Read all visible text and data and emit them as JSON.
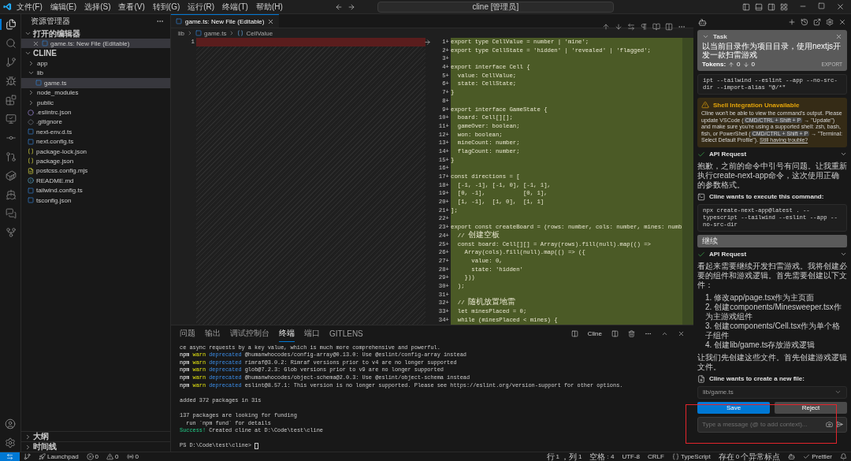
{
  "title_bar": {
    "menus": [
      "文件(F)",
      "编辑(E)",
      "选择(S)",
      "查看(V)",
      "转到(G)",
      "运行(R)",
      "终端(T)",
      "帮助(H)"
    ],
    "search": "cline [管理员]"
  },
  "activity_bar": [
    {
      "selected": true
    },
    {
      "selected": false
    },
    {
      "selected": false
    },
    {
      "selected": false
    },
    {
      "selected": false
    },
    {
      "selected": false
    },
    {
      "selected": false
    },
    {
      "selected": false
    },
    {
      "selected": false
    },
    {
      "selected": false
    },
    {
      "selected": false
    },
    {
      "selected": false
    }
  ],
  "sidebar": {
    "title": "资源管理器",
    "open_editors": {
      "label": "打开的编辑器",
      "expanded": true,
      "items": [
        {
          "name": "game.ts: New File (Editable)",
          "kind": "ts",
          "selected": true
        }
      ]
    },
    "project": {
      "label": "CLINE",
      "expanded": true,
      "tree": [
        {
          "name": "app",
          "kind": "folder",
          "expanded": false,
          "selected": false
        },
        {
          "name": "lib",
          "kind": "folder",
          "expanded": true,
          "selected": false,
          "children": [
            {
              "name": "game.ts",
              "kind": "ts",
              "selected": true
            }
          ]
        },
        {
          "name": "node_modules",
          "kind": "folder",
          "expanded": false,
          "selected": false
        },
        {
          "name": "public",
          "kind": "folder",
          "expanded": false,
          "selected": false
        },
        {
          "name": ".eslintrc.json",
          "kind": "eslint",
          "selected": false
        },
        {
          "name": ".gitignore",
          "kind": "git",
          "selected": false
        },
        {
          "name": "next-env.d.ts",
          "kind": "ts",
          "selected": false
        },
        {
          "name": "next.config.ts",
          "kind": "ts",
          "selected": false
        },
        {
          "name": "package-lock.json",
          "kind": "json",
          "selected": false
        },
        {
          "name": "package.json",
          "kind": "json",
          "selected": false
        },
        {
          "name": "postcss.config.mjs",
          "kind": "js",
          "selected": false
        },
        {
          "name": "README.md",
          "kind": "md",
          "selected": false
        },
        {
          "name": "tailwind.config.ts",
          "kind": "ts",
          "selected": false
        },
        {
          "name": "tsconfig.json",
          "kind": "tsconfig",
          "selected": false
        }
      ]
    },
    "bottom_sections": [
      {
        "label": "大纲",
        "expanded": false
      },
      {
        "label": "时间线",
        "expanded": false
      }
    ]
  },
  "editor": {
    "tabs": [
      {
        "label": "game.ts: New File (Editable)",
        "selected": true
      }
    ],
    "breadcrumb": [
      "lib",
      "game.ts",
      "CellValue"
    ],
    "left_lines": [
      {
        "number": "1"
      }
    ],
    "right_lines": [
      {
        "number": "1+",
        "code": "export type CellValue = number | 'mine';"
      },
      {
        "number": "2+",
        "code": "export type CellState = 'hidden' | 'revealed' | 'flagged';"
      },
      {
        "number": "3+"
      },
      {
        "number": "4+",
        "code": "export interface Cell {"
      },
      {
        "number": "5+",
        "code": "  value: CellValue;"
      },
      {
        "number": "6+",
        "code": "  state: CellState;"
      },
      {
        "number": "7+",
        "code": "}"
      },
      {
        "number": "8+"
      },
      {
        "number": "9+",
        "code": "export interface GameState {"
      },
      {
        "number": "10+",
        "code": "  board: Cell[][];"
      },
      {
        "number": "11+",
        "code": "  gameOver: boolean;"
      },
      {
        "number": "12+",
        "code": "  won: boolean;"
      },
      {
        "number": "13+",
        "code": "  mineCount: number;"
      },
      {
        "number": "14+",
        "code": "  flagCount: number;"
      },
      {
        "number": "15+",
        "code": "}"
      },
      {
        "number": "16+"
      },
      {
        "number": "17+",
        "code": "const directions = ["
      },
      {
        "number": "18+",
        "code": "  [-1, -1], [-1, 0], [-1, 1],"
      },
      {
        "number": "19+",
        "code": "  [0, -1],           [0, 1],"
      },
      {
        "number": "20+",
        "code": "  [1, -1],  [1, 0],  [1, 1]"
      },
      {
        "number": "21+",
        "code": "];"
      },
      {
        "number": "22+"
      },
      {
        "number": "23+",
        "code": "export const createBoard = (rows: number, cols: number, mines: numb"
      },
      {
        "number": "24+",
        "code": "  // 创建空板"
      },
      {
        "number": "25+",
        "code": "  const board: Cell[][] = Array(rows).fill(null).map(() =>"
      },
      {
        "number": "26+",
        "code": "    Array(cols).fill(null).map(() => ({"
      },
      {
        "number": "27+",
        "code": "      value: 0,"
      },
      {
        "number": "28+",
        "code": "      state: 'hidden'"
      },
      {
        "number": "29+",
        "code": "    }))"
      },
      {
        "number": "30+",
        "code": "  );"
      },
      {
        "number": "31+"
      },
      {
        "number": "32+",
        "code": "  // 随机放置地雷"
      },
      {
        "number": "33+",
        "code": "  let minesPlaced = 0;"
      },
      {
        "number": "34+",
        "code": "  while (minesPlaced < mines) {"
      }
    ]
  },
  "panel": {
    "tabs": [
      {
        "label": "问题",
        "selected": false
      },
      {
        "label": "输出",
        "selected": false
      },
      {
        "label": "调试控制台",
        "selected": false
      },
      {
        "label": "终端",
        "selected": true
      },
      {
        "label": "端口",
        "selected": false
      },
      {
        "label": "GITLENS",
        "selected": false
      }
    ],
    "terminal_name": "Cline",
    "lines": [
      {
        "kind": "plain",
        "parts": [
          "ce async requests by a key value, which is much more comprehensive and powerful."
        ]
      },
      {
        "kind": "npm-warn",
        "parts": [
          "npm",
          "warn",
          "deprecated",
          "@humanwhocodes/config-array@0.13.0: Use @eslint/config-array instead"
        ]
      },
      {
        "kind": "npm-warn",
        "parts": [
          "npm",
          "warn",
          "deprecated",
          "rimraf@3.0.2: Rimraf versions prior to v4 are no longer supported"
        ]
      },
      {
        "kind": "npm-warn",
        "parts": [
          "npm",
          "warn",
          "deprecated",
          "glob@7.2.3: Glob versions prior to v9 are no longer supported"
        ]
      },
      {
        "kind": "npm-warn",
        "parts": [
          "npm",
          "warn",
          "deprecated",
          "@humanwhocodes/object-schema@2.0.3: Use @eslint/object-schema instead"
        ]
      },
      {
        "kind": "npm-warn",
        "parts": [
          "npm",
          "warn",
          "deprecated",
          "eslint@8.57.1: This version is no longer supported. Please see https://eslint.org/version-support for other options."
        ]
      },
      {
        "kind": "blank"
      },
      {
        "kind": "plain",
        "parts": [
          "added 372 packages in 31s"
        ]
      },
      {
        "kind": "blank"
      },
      {
        "kind": "plain",
        "parts": [
          "137 packages are looking for funding"
        ]
      },
      {
        "kind": "plain",
        "parts": [
          "  run `npm fund` for details"
        ]
      },
      {
        "kind": "success",
        "parts": [
          "Success!",
          " Created cline at D:\\Code\\test\\cline"
        ]
      },
      {
        "kind": "blank"
      },
      {
        "kind": "prompt",
        "parts": [
          "PS D:\\Code\\test\\cline> "
        ]
      }
    ]
  },
  "cline": {
    "task": {
      "title": "Task",
      "text": "以当前目录作为项目目录，使用nextjs开发一款扫雷游戏",
      "tokens_label": "Tokens:",
      "tokens_up": "0",
      "tokens_down": "0",
      "export": "EXPORT"
    },
    "messages": [
      {
        "kind": "code",
        "text": "ipt --tailwind --eslint --app --no-src-dir --import-alias \"@/*\""
      },
      {
        "kind": "warning",
        "title": "Shell Integration Unavailable",
        "parts": [
          {
            "kind": "text",
            "text": "Cline won't be able to view the command's output. Please update VSCode ("
          },
          {
            "kind": "key",
            "text": "CMD/CTRL + Shift + P"
          },
          {
            "kind": "text",
            "text": " → \"Update\") and make sure you're using a supported shell: zsh, bash, fish, or PowerShell ("
          },
          {
            "kind": "key",
            "text": "CMD/CTRL + Shift + P"
          },
          {
            "kind": "text",
            "text": " → \"Terminal: Select Default Profile\"). "
          },
          {
            "kind": "link",
            "text": "Still having trouble?"
          }
        ]
      },
      {
        "kind": "api",
        "text": "API Request"
      },
      {
        "kind": "text",
        "text": "抱歉，之前的命令中引号有问题。让我重新执行create-next-app命令，这次使用正确的参数格式。"
      },
      {
        "kind": "command",
        "text": "Cline wants to execute this command:"
      },
      {
        "kind": "code",
        "text": "npx create-next-app@latest . --typescript --tailwind --eslint --app --no-src-dir"
      },
      {
        "kind": "button",
        "text": "继续"
      },
      {
        "kind": "api",
        "text": "API Request"
      },
      {
        "kind": "text",
        "text": "看起来需要继续开发扫雷游戏。我将创建必要的组件和游戏逻辑。首先需要创建以下文件："
      },
      {
        "kind": "list",
        "items": [
          "修改app/page.tsx作为主页面",
          "创建components/Minesweeper.tsx作为主游戏组件",
          "创建components/Cell.tsx作为单个格子组件",
          "创建lib/game.ts存放游戏逻辑"
        ],
        "numbers": [
          "1.",
          "2.",
          "3.",
          "4."
        ]
      },
      {
        "kind": "text",
        "text": "让我们先创建这些文件。首先创建游戏逻辑文件。"
      },
      {
        "kind": "newfile",
        "text": "Cline wants to create a new file:"
      },
      {
        "kind": "file",
        "text": "lib/game.ts"
      }
    ],
    "actions": [
      {
        "label": "Save",
        "kind": "primary"
      },
      {
        "label": "Reject",
        "kind": "secondary"
      }
    ],
    "input": {
      "placeholder": "Type a message (@ to add context)..."
    }
  },
  "status_bar": {
    "left": [
      {
        "kind": "remote"
      },
      {
        "kind": "graph"
      },
      {
        "kind": "launchpad",
        "text": "Launchpad"
      },
      {
        "kind": "errors",
        "text": "0"
      },
      {
        "kind": "warnings",
        "text": "0"
      },
      {
        "kind": "ports",
        "text": "0"
      }
    ],
    "right": [
      {
        "kind": "text",
        "text": "行 1，列 1"
      },
      {
        "kind": "text",
        "text": "空格: 4"
      },
      {
        "kind": "text",
        "text": "UTF-8"
      },
      {
        "kind": "text",
        "text": "CRLF"
      },
      {
        "kind": "language",
        "text": "TypeScript"
      },
      {
        "kind": "text",
        "text": "存在0个异常标点"
      },
      {
        "kind": "copilot"
      },
      {
        "kind": "prettier",
        "text": "Prettier"
      },
      {
        "kind": "bell"
      }
    ]
  },
  "annotation": {
    "kind": "red-frame"
  }
}
